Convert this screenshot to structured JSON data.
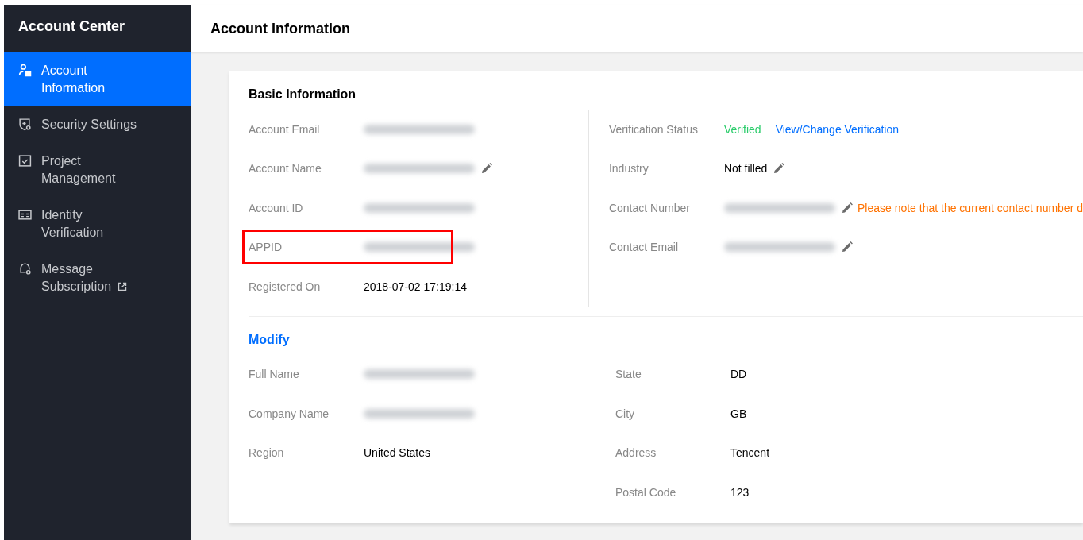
{
  "sidebar": {
    "title": "Account Center",
    "items": [
      {
        "label": "Account Information",
        "selected": true,
        "external": false
      },
      {
        "label": "Security Settings",
        "selected": false,
        "external": false
      },
      {
        "label": "Project Management",
        "selected": false,
        "external": false
      },
      {
        "label": "Identity Verification",
        "selected": false,
        "external": false
      },
      {
        "label": "Message Subscription",
        "selected": false,
        "external": true
      }
    ]
  },
  "header": {
    "title": "Account Information"
  },
  "sections": [
    {
      "title": "Basic Information",
      "kind": "heading",
      "columns": [
        [
          {
            "label": "Account Email",
            "kind": "redacted",
            "editable": false,
            "highlighted": false
          },
          {
            "label": "Account Name",
            "kind": "redacted",
            "editable": true,
            "highlighted": false
          },
          {
            "label": "Account ID",
            "kind": "redacted",
            "editable": false,
            "highlighted": false
          },
          {
            "label": "APPID",
            "kind": "redacted",
            "editable": false,
            "highlighted": true
          },
          {
            "label": "Registered On",
            "kind": "text",
            "value": "2018-07-02 17:19:14",
            "editable": false,
            "highlighted": false
          }
        ],
        [
          {
            "label": "Verification Status",
            "kind": "status",
            "value": "Verified",
            "link": "View/Change Verification",
            "editable": false,
            "highlighted": false
          },
          {
            "label": "Industry",
            "kind": "text",
            "value": "Not filled",
            "editable": true,
            "highlighted": false
          },
          {
            "label": "Contact Number",
            "kind": "redacted",
            "editable": true,
            "highlighted": false,
            "note": "Please note that the current contact number d"
          },
          {
            "label": "Contact Email",
            "kind": "redacted",
            "editable": true,
            "highlighted": false
          }
        ]
      ]
    },
    {
      "title": "Modify",
      "kind": "link",
      "columns": [
        [
          {
            "label": "Full Name",
            "kind": "redacted",
            "editable": false,
            "highlighted": false
          },
          {
            "label": "Company Name",
            "kind": "redacted",
            "editable": false,
            "highlighted": false
          },
          {
            "label": "Region",
            "kind": "text",
            "value": "United States",
            "editable": false,
            "highlighted": false
          }
        ],
        [
          {
            "label": "State",
            "kind": "text",
            "value": "DD",
            "editable": false,
            "highlighted": false
          },
          {
            "label": "City",
            "kind": "text",
            "value": "GB",
            "editable": false,
            "highlighted": false
          },
          {
            "label": "Address",
            "kind": "text",
            "value": "Tencent",
            "editable": false,
            "highlighted": false
          },
          {
            "label": "Postal Code",
            "kind": "text",
            "value": "123",
            "editable": false,
            "highlighted": false
          }
        ]
      ]
    }
  ]
}
